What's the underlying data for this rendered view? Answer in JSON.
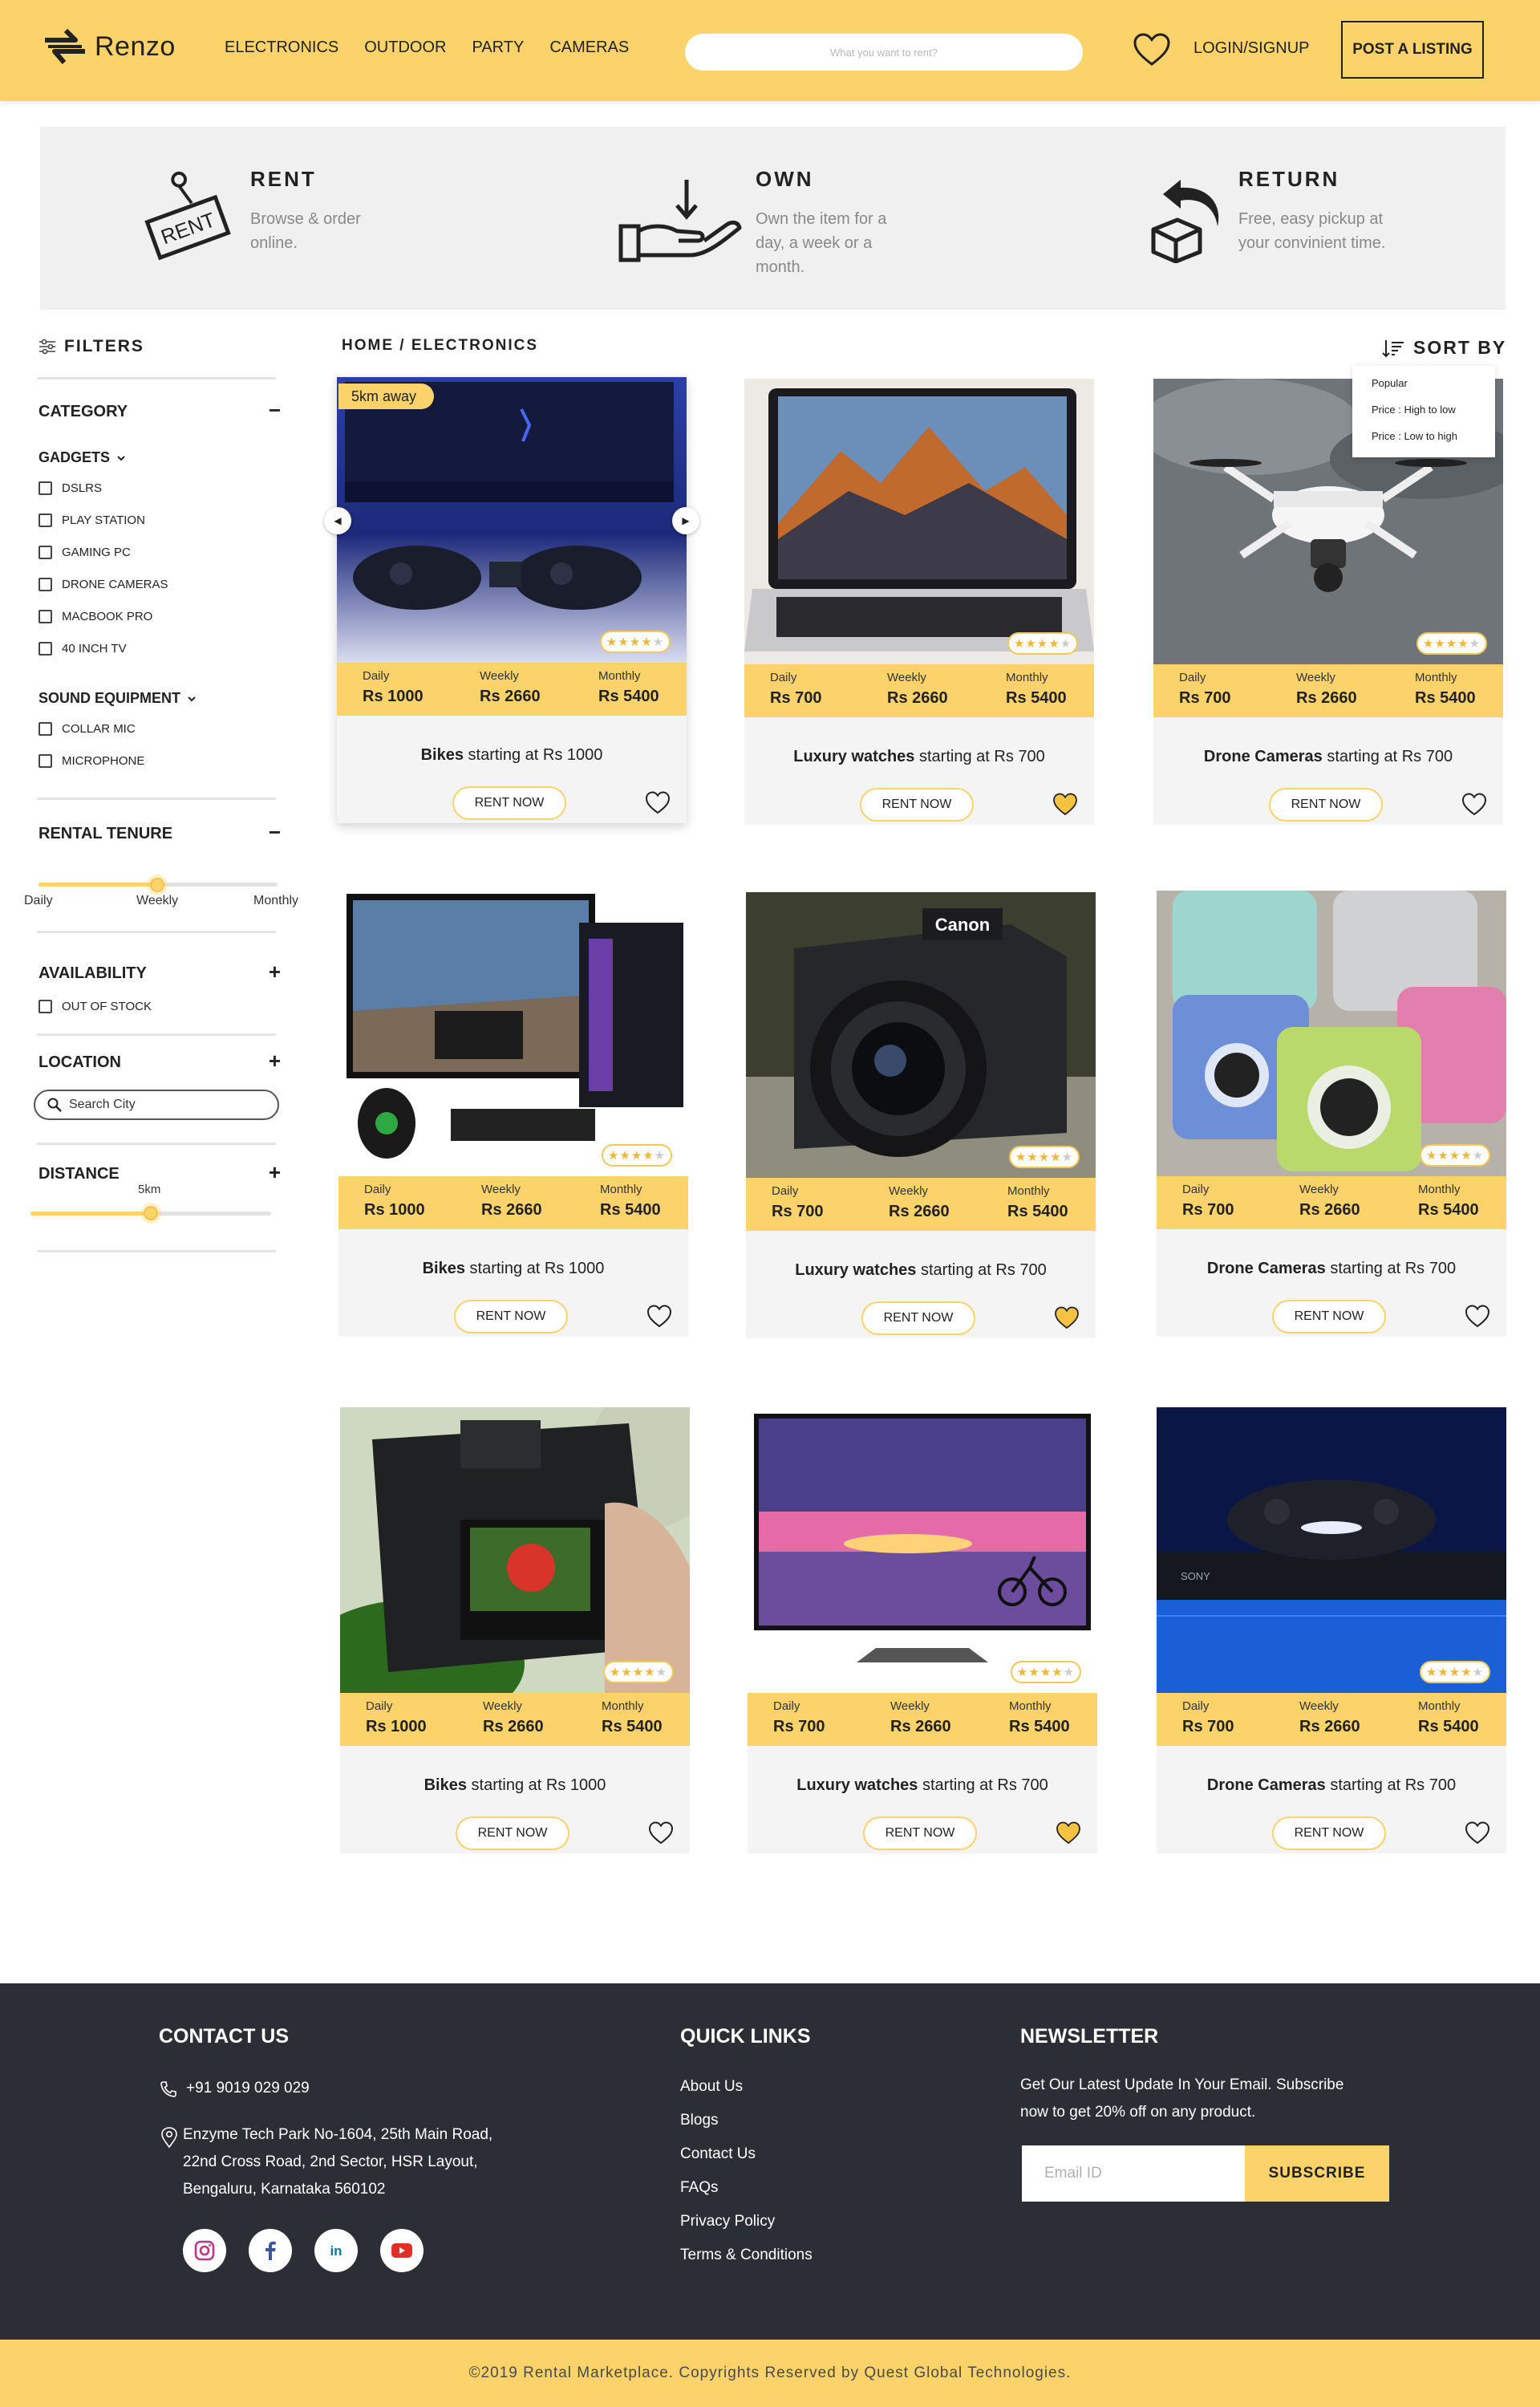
{
  "header": {
    "logo_text": "Renzo",
    "nav": [
      "ELECTRONICS",
      "OUTDOOR",
      "PARTY",
      "CAMERAS"
    ],
    "search_placeholder": "What you want to rent?",
    "login_label": "LOGIN/SIGNUP",
    "post_label": "POST A LISTING"
  },
  "hero": [
    {
      "title": "RENT",
      "desc": "Browse & order online.",
      "icon": "rent-sign-icon"
    },
    {
      "title": "OWN",
      "desc": "Own the item for a day, a week or a month.",
      "icon": "hand-receive-icon"
    },
    {
      "title": "RETURN",
      "desc": "Free, easy pickup at your convinient time.",
      "icon": "box-return-icon"
    }
  ],
  "sidebar": {
    "filters_label": "FILTERS",
    "category_title": "CATEGORY",
    "gadgets_label": "GADGETS",
    "gadgets": [
      "DSLRS",
      "PLAY STATION",
      "GAMING PC",
      "DRONE CAMERAS",
      "MACBOOK PRO",
      "40 INCH TV"
    ],
    "sound_label": "SOUND EQUIPMENT",
    "sound": [
      "COLLAR MIC",
      "MICROPHONE"
    ],
    "tenure_title": "RENTAL TENURE",
    "tenure_ticks": [
      "Daily",
      "Weekly",
      "Monthly"
    ],
    "tenure_value": "Weekly",
    "availability_title": "AVAILABILITY",
    "availability_option": "OUT OF STOCK",
    "location_title": "LOCATION",
    "location_placeholder": "Search City",
    "distance_title": "DISTANCE",
    "distance_value": "5km",
    "distance_fraction": 0.5,
    "collapse_symbol": "−",
    "expand_symbol": "+"
  },
  "main": {
    "breadcrumb": "HOME / ELECTRONICS",
    "sort_label": "SORT BY",
    "sort_options": [
      "Popular",
      "Price : High to low",
      "Price : Low to high"
    ],
    "price_labels": [
      "Daily",
      "Weekly",
      "Monthly"
    ],
    "rent_label": "RENT NOW",
    "starting_text": "starting at",
    "away_badge": "5km away"
  },
  "products": [
    {
      "name": "Bikes",
      "price": "Rs 1000",
      "daily": "Rs 1000",
      "weekly": "Rs 2660",
      "monthly": "Rs 5400",
      "rating": 4,
      "favorited": false,
      "image": "playstation-2"
    },
    {
      "name": "Luxury watches",
      "price": "Rs 700",
      "daily": "Rs 700",
      "weekly": "Rs 2660",
      "monthly": "Rs 5400",
      "rating": 4,
      "favorited": true,
      "image": "macbook"
    },
    {
      "name": "Drone Cameras",
      "price": "Rs 700",
      "daily": "Rs 700",
      "weekly": "Rs 2660",
      "monthly": "Rs 5400",
      "rating": 4,
      "favorited": false,
      "image": "drone"
    },
    {
      "name": "Bikes",
      "price": "Rs 1000",
      "daily": "Rs 1000",
      "weekly": "Rs 2660",
      "monthly": "Rs 5400",
      "rating": 4,
      "favorited": false,
      "image": "gaming-pc"
    },
    {
      "name": "Luxury watches",
      "price": "Rs 700",
      "daily": "Rs 700",
      "weekly": "Rs 2660",
      "monthly": "Rs 5400",
      "rating": 4,
      "favorited": true,
      "image": "canon-camera"
    },
    {
      "name": "Drone Cameras",
      "price": "Rs 700",
      "daily": "Rs 700",
      "weekly": "Rs 2660",
      "monthly": "Rs 5400",
      "rating": 4,
      "favorited": false,
      "image": "instax-cameras"
    },
    {
      "name": "Bikes",
      "price": "Rs 1000",
      "daily": "Rs 1000",
      "weekly": "Rs 2660",
      "monthly": "Rs 5400",
      "rating": 4,
      "favorited": false,
      "image": "nikon-camera"
    },
    {
      "name": "Luxury watches",
      "price": "Rs 700",
      "daily": "Rs 700",
      "weekly": "Rs 2660",
      "monthly": "Rs 5400",
      "rating": 4,
      "favorited": true,
      "image": "tv"
    },
    {
      "name": "Drone Cameras",
      "price": "Rs 700",
      "daily": "Rs 700",
      "weekly": "Rs 2660",
      "monthly": "Rs 5400",
      "rating": 4,
      "favorited": false,
      "image": "playstation-4"
    }
  ],
  "footer": {
    "contact_title": "CONTACT US",
    "phone": "+91 9019 029 029",
    "address_lines": [
      "Enzyme Tech Park No-1604, 25th Main Road,",
      "22nd Cross Road, 2nd Sector, HSR Layout,",
      "Bengaluru, Karnataka 560102"
    ],
    "social": [
      "instagram-icon",
      "facebook-icon",
      "linkedin-icon",
      "youtube-icon"
    ],
    "links_title": "QUICK LINKS",
    "links": [
      "About Us",
      "Blogs",
      "Contact Us",
      "FAQs",
      "Privacy Policy",
      "Terms & Conditions"
    ],
    "newsletter_title": "NEWSLETTER",
    "newsletter_lines": [
      "Get Our Latest Update In Your Email. Subscribe",
      "now to get 20% off on any product."
    ],
    "email_placeholder": "Email ID",
    "subscribe_label": "SUBSCRIBE",
    "copyright": "©2019 Rental Marketplace. Copyrights Reserved by Quest Global Technologies."
  },
  "colors": {
    "accent": "#fcd36b",
    "footer_bg": "#2b2e35",
    "hero_bg": "#f0f0f0",
    "card_bg": "#f4f4f4"
  }
}
